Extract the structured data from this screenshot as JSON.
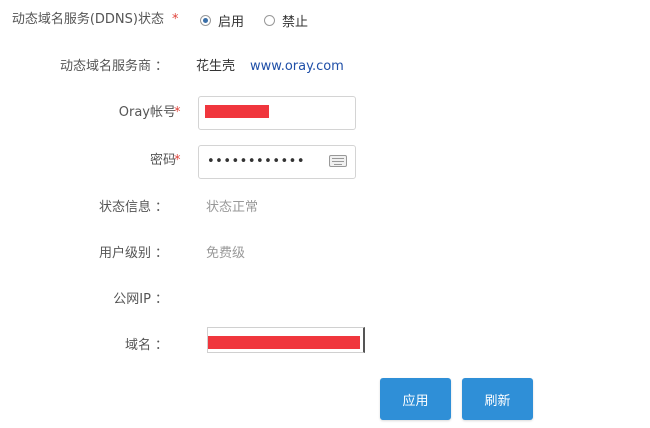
{
  "form": {
    "ddns_status": {
      "label": "动态域名服务(DDNS)状态",
      "required_mark": "*",
      "options": [
        {
          "label": "启用",
          "selected": true
        },
        {
          "label": "禁止",
          "selected": false
        }
      ]
    },
    "provider": {
      "label": "动态域名服务商",
      "colon": "：",
      "name": "花生壳",
      "url": "www.oray.com"
    },
    "account": {
      "label": "Oray帐号",
      "required_mark": "*"
    },
    "password": {
      "label": "密码",
      "required_mark": "*",
      "masked_value": "••••••••••••",
      "icon": "keyboard-icon"
    },
    "status_info": {
      "label": "状态信息",
      "colon": "：",
      "value": "状态正常"
    },
    "user_level": {
      "label": "用户级别",
      "colon": "：",
      "value": "免费级"
    },
    "public_ip": {
      "label": "公网IP",
      "colon": "：",
      "value": ""
    },
    "domain": {
      "label": "域名",
      "colon": "："
    }
  },
  "buttons": {
    "apply": "应用",
    "refresh": "刷新"
  },
  "colors": {
    "button_bg": "#2f8fd7",
    "required_mark": "#e0433b",
    "link": "#1f4fa8",
    "redaction": "#f0363d"
  }
}
